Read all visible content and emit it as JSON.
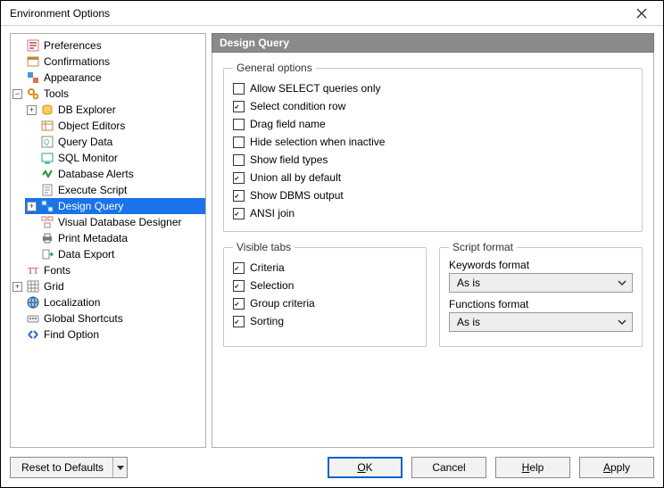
{
  "window": {
    "title": "Environment Options"
  },
  "tree": {
    "preferences": "Preferences",
    "confirmations": "Confirmations",
    "appearance": "Appearance",
    "tools": "Tools",
    "db_explorer": "DB Explorer",
    "object_editors": "Object Editors",
    "query_data": "Query Data",
    "sql_monitor": "SQL Monitor",
    "database_alerts": "Database Alerts",
    "execute_script": "Execute Script",
    "design_query": "Design Query",
    "visual_db_designer": "Visual Database Designer",
    "print_metadata": "Print Metadata",
    "data_export": "Data Export",
    "fonts": "Fonts",
    "grid": "Grid",
    "localization": "Localization",
    "global_shortcuts": "Global Shortcuts",
    "find_option": "Find Option"
  },
  "panel": {
    "title": "Design Query",
    "general": {
      "legend": "General options",
      "items": {
        "allow_select_only": {
          "label": "Allow SELECT queries only",
          "checked": false
        },
        "select_condition_row": {
          "label": "Select condition row",
          "checked": true
        },
        "drag_field_name": {
          "label": "Drag field name",
          "checked": false
        },
        "hide_selection_inactive": {
          "label": "Hide selection when inactive",
          "checked": false
        },
        "show_field_types": {
          "label": "Show field types",
          "checked": false
        },
        "union_all_default": {
          "label": "Union all by default",
          "checked": true
        },
        "show_dbms_output": {
          "label": "Show DBMS output",
          "checked": true
        },
        "ansi_join": {
          "label": "ANSI join",
          "checked": true
        }
      }
    },
    "visible_tabs": {
      "legend": "Visible tabs",
      "items": {
        "criteria": {
          "label": "Criteria",
          "checked": true
        },
        "selection": {
          "label": "Selection",
          "checked": true
        },
        "group_criteria": {
          "label": "Group criteria",
          "checked": true
        },
        "sorting": {
          "label": "Sorting",
          "checked": true
        }
      }
    },
    "script_format": {
      "legend": "Script format",
      "keywords_label": "Keywords format",
      "keywords_value": "As is",
      "functions_label": "Functions format",
      "functions_value": "As is"
    }
  },
  "footer": {
    "reset": "Reset to Defaults",
    "ok": "OK",
    "cancel": "Cancel",
    "help": "Help",
    "apply": "Apply"
  }
}
